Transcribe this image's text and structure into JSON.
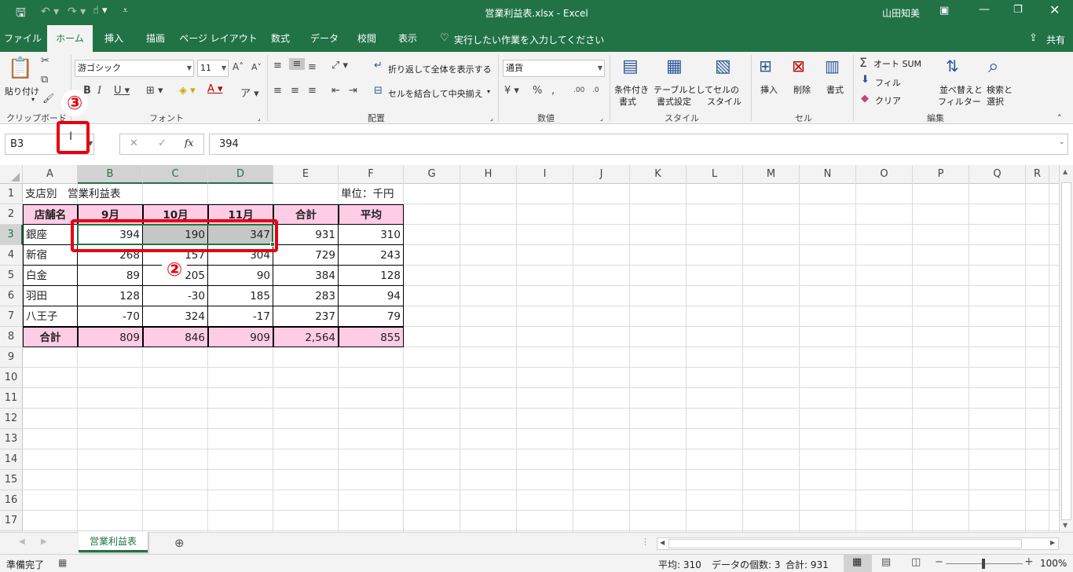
{
  "titlebar": {
    "doc_title": "営業利益表.xlsx  -  Excel",
    "user": "山田知美"
  },
  "tabs": [
    "ファイル",
    "ホーム",
    "挿入",
    "描画",
    "ページ レイアウト",
    "数式",
    "データ",
    "校閲",
    "表示"
  ],
  "tell_me": "実行したい作業を入力してください",
  "share": "共有",
  "ribbon": {
    "clipboard": {
      "paste": "貼り付け",
      "label": "クリップボード"
    },
    "font": {
      "name": "游ゴシック",
      "size": "11",
      "label": "フォント"
    },
    "align": {
      "wrap": "折り返して全体を表示する",
      "merge": "セルを結合して中央揃え",
      "label": "配置"
    },
    "number": {
      "format": "通貨",
      "label": "数値"
    },
    "styles": {
      "cond": "条件付き",
      "cond2": "書式",
      "table": "テーブルとして",
      "table2": "書式設定",
      "cell": "セルの",
      "cell2": "スタイル",
      "label": "スタイル"
    },
    "cells": {
      "insert": "挿入",
      "delete": "削除",
      "format": "書式",
      "label": "セル"
    },
    "edit": {
      "autosum": "オート SUM",
      "fill": "フィル",
      "clear": "クリア",
      "sort": "並べ替えと",
      "sort2": "フィルター",
      "find": "検索と",
      "find2": "選択",
      "label": "編集"
    }
  },
  "formula_bar": {
    "name_box": "B3",
    "formula": "394",
    "fx": "fx"
  },
  "columns": [
    "A",
    "B",
    "C",
    "D",
    "E",
    "F",
    "G",
    "H",
    "I",
    "J",
    "K",
    "L",
    "M",
    "N",
    "O",
    "P",
    "Q",
    "R"
  ],
  "rows": [
    "1",
    "2",
    "3",
    "4",
    "5",
    "6",
    "7",
    "8",
    "9",
    "10",
    "11",
    "12",
    "13",
    "14",
    "15",
    "16",
    "17"
  ],
  "table": {
    "title": "支店別　営業利益表",
    "unit": "単位：千円",
    "headers": [
      "店舗名",
      "9月",
      "10月",
      "11月",
      "合計",
      "平均"
    ],
    "data": [
      [
        "銀座",
        "394",
        "190",
        "347",
        "931",
        "310"
      ],
      [
        "新宿",
        "268",
        "157",
        "304",
        "729",
        "243"
      ],
      [
        "白金",
        "89",
        "205",
        "90",
        "384",
        "128"
      ],
      [
        "羽田",
        "128",
        "-30",
        "185",
        "283",
        "94"
      ],
      [
        "八王子",
        "-70",
        "324",
        "-17",
        "237",
        "79"
      ]
    ],
    "total": [
      "合計",
      "809",
      "846",
      "909",
      "2,564",
      "855"
    ]
  },
  "sheet_tab": "営業利益表",
  "status": {
    "ready": "準備完了",
    "avg": "平均: 310",
    "count": "データの個数: 3",
    "sum": "合計: 931",
    "zoom": "100%"
  },
  "annotations": {
    "step2": "②",
    "step3": "③"
  },
  "colors": {
    "accent": "#217346",
    "highlight": "#ffcce5",
    "annotation": "#e60012"
  }
}
